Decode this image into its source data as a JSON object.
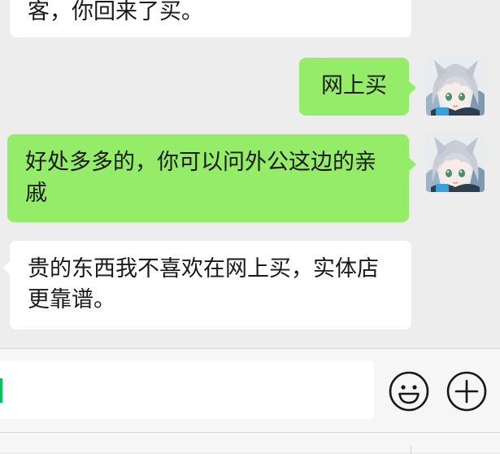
{
  "messages": [
    {
      "id": "msg-1",
      "direction": "incoming",
      "text": "客，你回来了买。"
    },
    {
      "id": "msg-2",
      "direction": "outgoing",
      "text": "网上买"
    },
    {
      "id": "msg-3",
      "direction": "outgoing",
      "text": "好处多多的，你可以问外公这边的亲戚"
    },
    {
      "id": "msg-4",
      "direction": "incoming",
      "text": "贵的东西我不喜欢在网上买，实体店更靠谱。"
    }
  ],
  "input": {
    "value": ""
  },
  "icons": {
    "emoji": "emoji-icon",
    "plus": "plus-icon",
    "avatar": "anime-avatar-icon"
  },
  "colors": {
    "background": "#ededed",
    "incoming_bubble": "#ffffff",
    "outgoing_bubble": "#95ec69",
    "cursor": "#07c160"
  }
}
